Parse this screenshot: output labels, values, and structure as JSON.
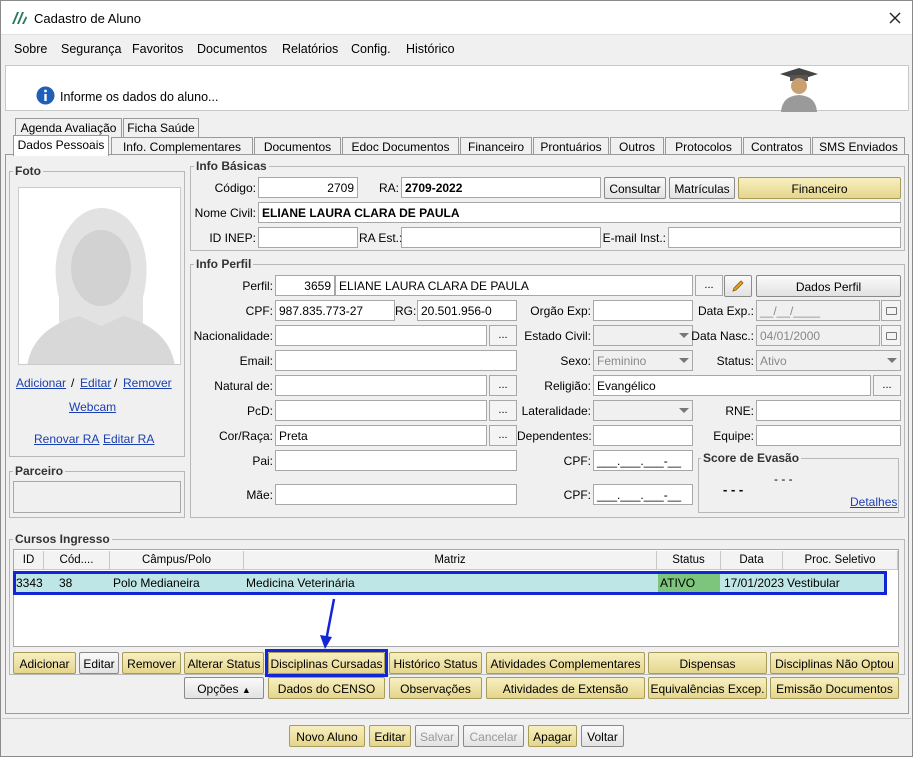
{
  "window": {
    "title": "Cadastro de Aluno"
  },
  "menu": [
    "Sobre",
    "Segurança",
    "Favoritos",
    "Documentos",
    "Relatórios",
    "Config.",
    "Histórico"
  ],
  "info": {
    "message": "Informe os dados do aluno..."
  },
  "tabs_top": [
    "Agenda Avaliação",
    "Ficha Saúde"
  ],
  "tabs": [
    "Dados Pessoais",
    "Info. Complementares",
    "Documentos",
    "Edoc Documentos",
    "Financeiro",
    "Prontuários",
    "Outros",
    "Protocolos",
    "Contratos",
    "SMS Enviados"
  ],
  "foto": {
    "title": "Foto",
    "adicionar": "Adicionar",
    "sep1": "/",
    "editar": "Editar",
    "sep2": "/",
    "remover": "Remover",
    "webcam": "Webcam",
    "renovar_ra": "Renovar RA",
    "editar_ra": "Editar RA"
  },
  "parceiro": {
    "title": "Parceiro"
  },
  "info_basicas": {
    "title": "Info Básicas",
    "codigo_label": "Código:",
    "codigo": "2709",
    "ra_label": "RA:",
    "ra": "2709-2022",
    "consultar": "Consultar",
    "matriculas": "Matrículas",
    "financeiro": "Financeiro",
    "nome_label": "Nome Civil:",
    "nome": "ELIANE LAURA CLARA DE PAULA",
    "inep_label": "ID INEP:",
    "ra_est_label": "RA Est.:",
    "email_inst_label": "E-mail Inst.:"
  },
  "info_perfil": {
    "title": "Info Perfil",
    "perfil_label": "Perfil:",
    "perfil_id": "3659",
    "perfil_nome": "ELIANE LAURA CLARA DE PAULA",
    "dots": "...",
    "dados_perfil": "Dados Perfil",
    "cpf_label": "CPF:",
    "cpf": "987.835.773-27",
    "rg_label": "RG:",
    "rg": "20.501.956-0",
    "orgao_label": "Orgão Exp:",
    "data_exp_label": "Data Exp.:",
    "data_exp": "__/__/____",
    "nacionalidade_label": "Nacionalidade:",
    "estado_civil_label": "Estado Civil:",
    "data_nasc_label": "Data Nasc.:",
    "data_nasc": "04/01/2000",
    "email_label": "Email:",
    "sexo_label": "Sexo:",
    "sexo": "Feminino",
    "status_label": "Status:",
    "status": "Ativo",
    "natural_label": "Natural de:",
    "religiao_label": "Religião:",
    "religiao": "Evangélico",
    "pcd_label": "PcD:",
    "lateralidade_label": "Lateralidade:",
    "rne_label": "RNE:",
    "cor_label": "Cor/Raça:",
    "cor": "Preta",
    "dependentes_label": "Dependentes:",
    "equipe_label": "Equipe:",
    "pai_label": "Pai:",
    "cpf_pai_label": "CPF:",
    "cpf_mask": "___.___.___-__",
    "mae_label": "Mãe:",
    "cpf_mae_label": "CPF:",
    "score_title": "Score de Evasão",
    "score_a": "- - -",
    "score_b": "- - -",
    "detalhes": "Detalhes"
  },
  "cursos": {
    "title": "Cursos Ingresso",
    "columns": [
      "ID",
      "Cód....",
      "Câmpus/Polo",
      "Matriz",
      "Status",
      "Data",
      "Proc. Seletivo"
    ],
    "row": {
      "id": "3343",
      "cod": "38",
      "campus": "Polo Medianeira",
      "matriz": "Medicina Veterinária",
      "status": "ATIVO",
      "data": "17/01/2023",
      "proc": "Vestibular"
    }
  },
  "buttons_row1": [
    "Adicionar",
    "Editar",
    "Remover",
    "Alterar Status",
    "Disciplinas Cursadas",
    "Histórico Status",
    "Atividades Complementares",
    "Dispensas",
    "Disciplinas Não Optou"
  ],
  "buttons_row2": {
    "opcoes": "Opções",
    "items": [
      "Dados do CENSO",
      "Observações",
      "Atividades de Extensão",
      "Equivalências Excep.",
      "Emissão Documentos"
    ]
  },
  "footer": [
    "Novo Aluno",
    "Editar",
    "Salvar",
    "Cancelar",
    "Apagar",
    "Voltar"
  ],
  "colors": {
    "highlight_border": "#1226d6",
    "row_bg": "#bfe6e6",
    "status_bg": "#7dc47d",
    "yellow_btn": "#e8da96"
  }
}
